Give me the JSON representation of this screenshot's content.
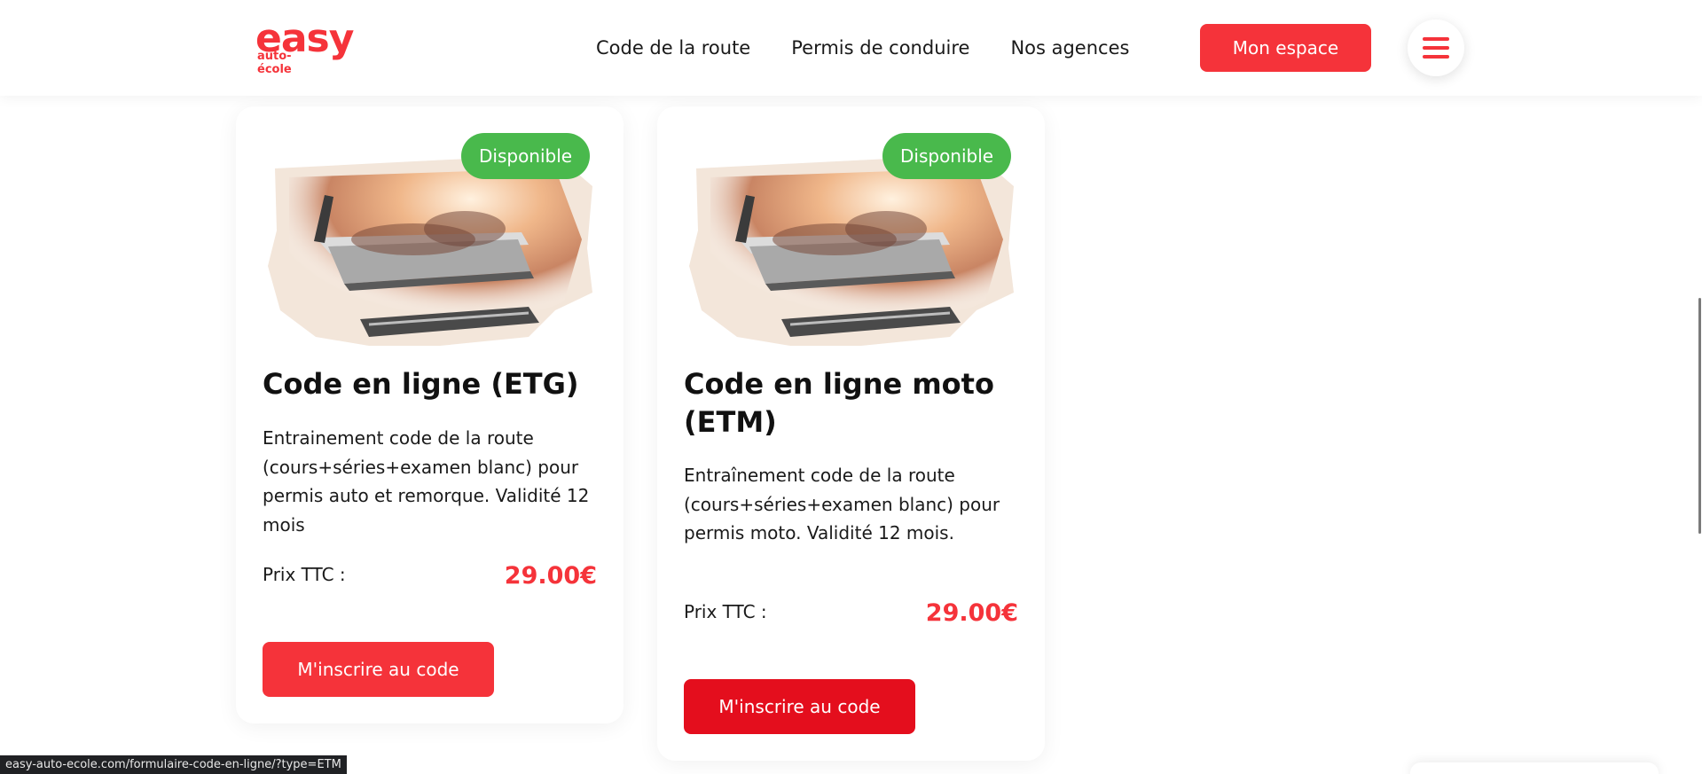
{
  "brand": {
    "logo_main": "easy",
    "logo_sub_1": "auto-",
    "logo_sub_2": "école",
    "accent_color": "#f5333a",
    "available_color": "#49b94c"
  },
  "nav": {
    "items": [
      {
        "label": "Code de la route"
      },
      {
        "label": "Permis de conduire"
      },
      {
        "label": "Nos agences"
      }
    ],
    "cta_label": "Mon espace",
    "menu_icon": "hamburger-menu-icon"
  },
  "cards": [
    {
      "badge": "Disponible",
      "title": "Code en ligne (ETG)",
      "description": "Entrainement code de la route (cours+séries+examen blanc) pour permis auto et remorque. Validité 12 mois",
      "price_label": "Prix TTC :",
      "price": "29.00€",
      "button_label": "M'inscrire au code"
    },
    {
      "badge": "Disponible",
      "title": "Code en ligne moto (ETM)",
      "description": "Entraînement code de la route (cours+séries+examen blanc) pour permis moto. Validité 12 mois.",
      "price_label": "Prix TTC :",
      "price": "29.00€",
      "button_label": "M'inscrire au code"
    }
  ],
  "status_bar": {
    "url": "easy-auto-ecole.com/formulaire-code-en-ligne/?type=ETM"
  }
}
